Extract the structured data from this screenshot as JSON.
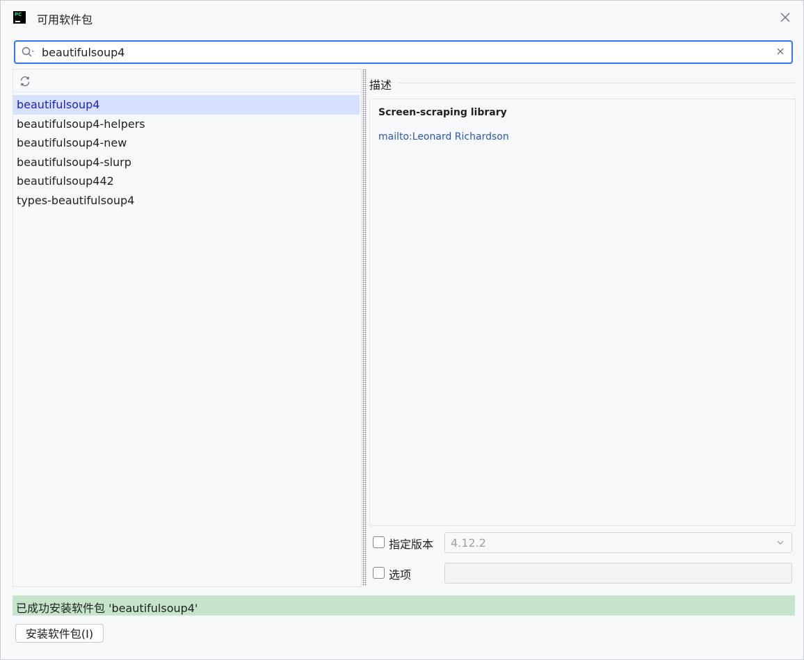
{
  "window": {
    "title": "可用软件包",
    "app_icon": "pycharm-icon",
    "close_icon": "close-icon"
  },
  "search": {
    "value": "beautifulsoup4",
    "icon": "search-icon",
    "clear_icon": "clear-icon"
  },
  "packages": {
    "refresh_icon": "refresh-icon",
    "items": [
      {
        "label": "beautifulsoup4",
        "selected": true
      },
      {
        "label": "beautifulsoup4-helpers"
      },
      {
        "label": "beautifulsoup4-new"
      },
      {
        "label": "beautifulsoup4-slurp"
      },
      {
        "label": "beautifulsoup442"
      },
      {
        "label": "types-beautifulsoup4"
      }
    ]
  },
  "description": {
    "header": "描述",
    "title": "Screen-scraping library",
    "link": "mailto:Leonard Richardson"
  },
  "options": {
    "version_label": "指定版本",
    "version_checked": false,
    "version_value": "4.12.2",
    "options_label": "选项",
    "options_checked": false,
    "options_value": ""
  },
  "status": {
    "text": "已成功安装软件包 'beautifulsoup4'"
  },
  "install_button": {
    "label": "安装软件包(I)"
  },
  "colors": {
    "accent": "#3574f0",
    "selection": "#d5e1ff",
    "selected_text": "#2121c9",
    "link": "#2a58b8",
    "success_bg": "#c5e4c9"
  }
}
